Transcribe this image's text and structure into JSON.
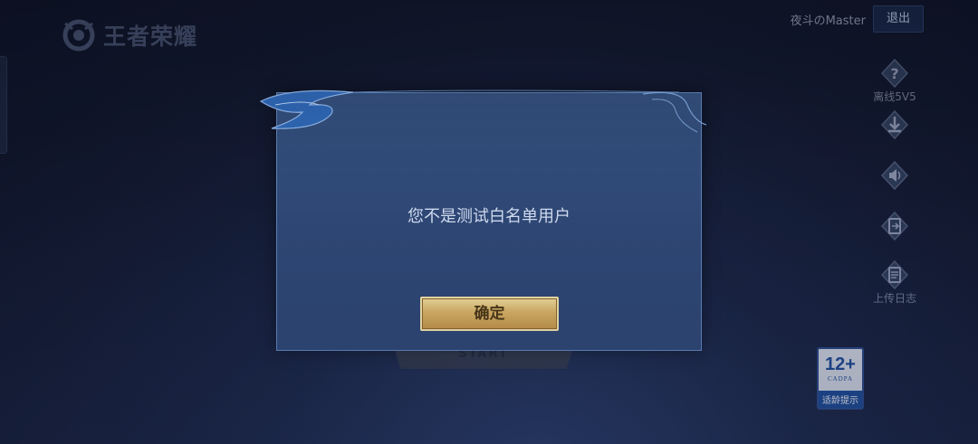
{
  "app": {
    "logo_text": "王者荣耀"
  },
  "header": {
    "username": "夜斗のMaster",
    "logout_label": "退出"
  },
  "side_tools": [
    {
      "icon": "question-icon",
      "label": "离线5V5"
    },
    {
      "icon": "download-icon",
      "label": ""
    },
    {
      "icon": "speaker-icon",
      "label": ""
    },
    {
      "icon": "switch-account-icon",
      "label": ""
    },
    {
      "icon": "log-icon",
      "label": "上传日志"
    }
  ],
  "background": {
    "start_plate_label": "START"
  },
  "rating": {
    "age": "12+",
    "org": "CADPA",
    "tip": "适龄提示"
  },
  "dialog": {
    "message": "您不是测试白名单用户",
    "confirm_label": "确定"
  },
  "colors": {
    "dialog_bg": "#2e4673",
    "dialog_border": "#5f83b9",
    "confirm_gold": "#d8b15f"
  }
}
